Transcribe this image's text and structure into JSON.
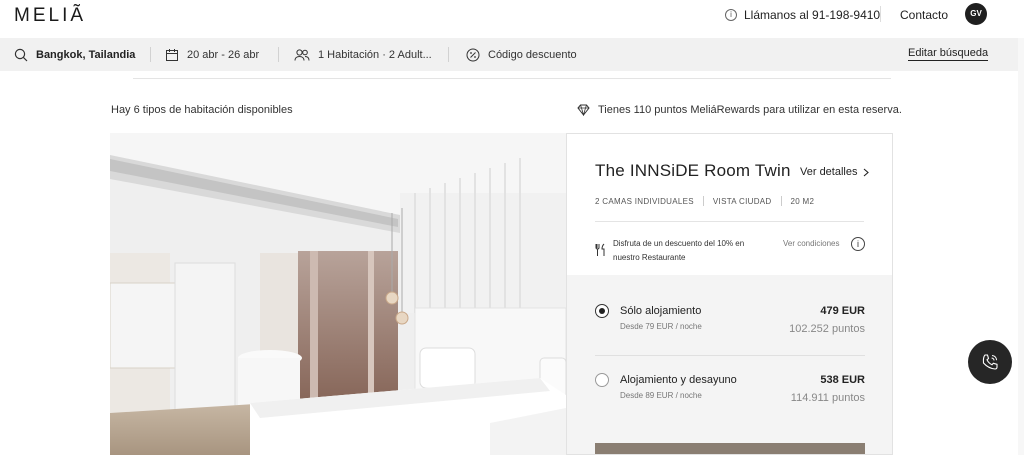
{
  "header": {
    "logo": "MELIÃ",
    "phone_label": "Llámanos al 91-198-9410",
    "contact_label": "Contacto",
    "avatar_initials": "GV"
  },
  "search": {
    "destination": "Bangkok, Tailandia",
    "dates": "20 abr - 26 abr",
    "rooms": "1 Habitación · 2 Adult...",
    "discount_code": "Código descuento",
    "edit_label": "Editar búsqueda"
  },
  "summary": {
    "room_types": "Hay 6 tipos de habitación disponibles",
    "rewards": "Tienes 110 puntos MeliáRewards para utilizar en esta reserva."
  },
  "room": {
    "title": "The INNSiDE Room Twin",
    "details_link": "Ver detalles",
    "features": [
      "2 CAMAS INDIVIDUALES",
      "VISTA CIUDAD",
      "20 M2"
    ],
    "promo_text": "Disfruta de un descuento del 10% en nuestro Restaurante",
    "promo_link": "Ver condiciones",
    "rates": [
      {
        "name": "Sólo alojamiento",
        "from": "Desde 79 EUR / noche",
        "price": "479 EUR",
        "points": "102.252 puntos",
        "selected": true
      },
      {
        "name": "Alojamiento y desayuno",
        "from": "Desde 89 EUR / noche",
        "price": "538 EUR",
        "points": "114.911 puntos",
        "selected": false
      }
    ]
  },
  "colors": {
    "accent": "#8a7e72",
    "dark": "#1f1f1f",
    "searchbar_bg": "#f1f1f1"
  },
  "icons": {
    "info": "info-icon",
    "search": "search-icon",
    "calendar": "calendar-icon",
    "guests": "users-icon",
    "discount": "percent-badge-icon",
    "rewards": "diamond-icon",
    "promo": "cutlery-icon",
    "call": "phone-call-icon"
  }
}
